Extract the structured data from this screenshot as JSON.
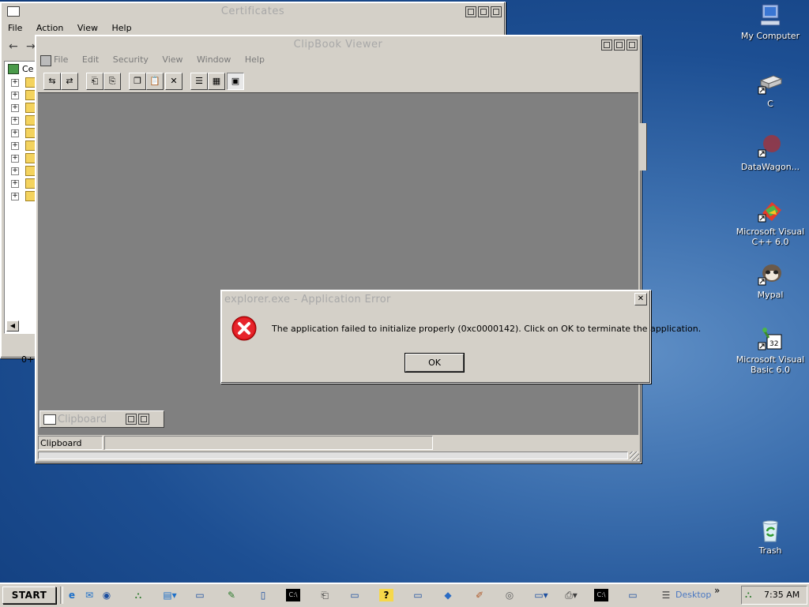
{
  "certificates_window": {
    "title": "Certificates",
    "menu": [
      "File",
      "Action",
      "View",
      "Help"
    ],
    "tree_root_label": "Ce",
    "bottom_text": "0+"
  },
  "clipbook": {
    "title": "ClipBook Viewer",
    "menu": [
      "File",
      "Edit",
      "Security",
      "View",
      "Window",
      "Help"
    ],
    "inner_window_title": "Clipboard",
    "status_text": "Clipboard"
  },
  "error_dialog": {
    "title": "explorer.exe - Application Error",
    "message": "The application failed to initialize properly (0xc0000142). Click on OK to terminate the application.",
    "ok_label": "OK",
    "close_glyph": "✕"
  },
  "desktop_icons": [
    {
      "name": "my-computer",
      "label": "My Computer"
    },
    {
      "name": "c-drive",
      "label": "C"
    },
    {
      "name": "datawagon",
      "label": "DataWagon..."
    },
    {
      "name": "visual-cpp",
      "label": "Microsoft Visual C++ 6.0"
    },
    {
      "name": "mypal",
      "label": "Mypal"
    },
    {
      "name": "visual-basic",
      "label": "Microsoft Visual Basic 6.0"
    },
    {
      "name": "trash",
      "label": "Trash"
    }
  ],
  "taskbar": {
    "start_label": "START",
    "desktop_label": "Desktop",
    "overflow_glyph": "»",
    "clock": "7:35 AM"
  }
}
